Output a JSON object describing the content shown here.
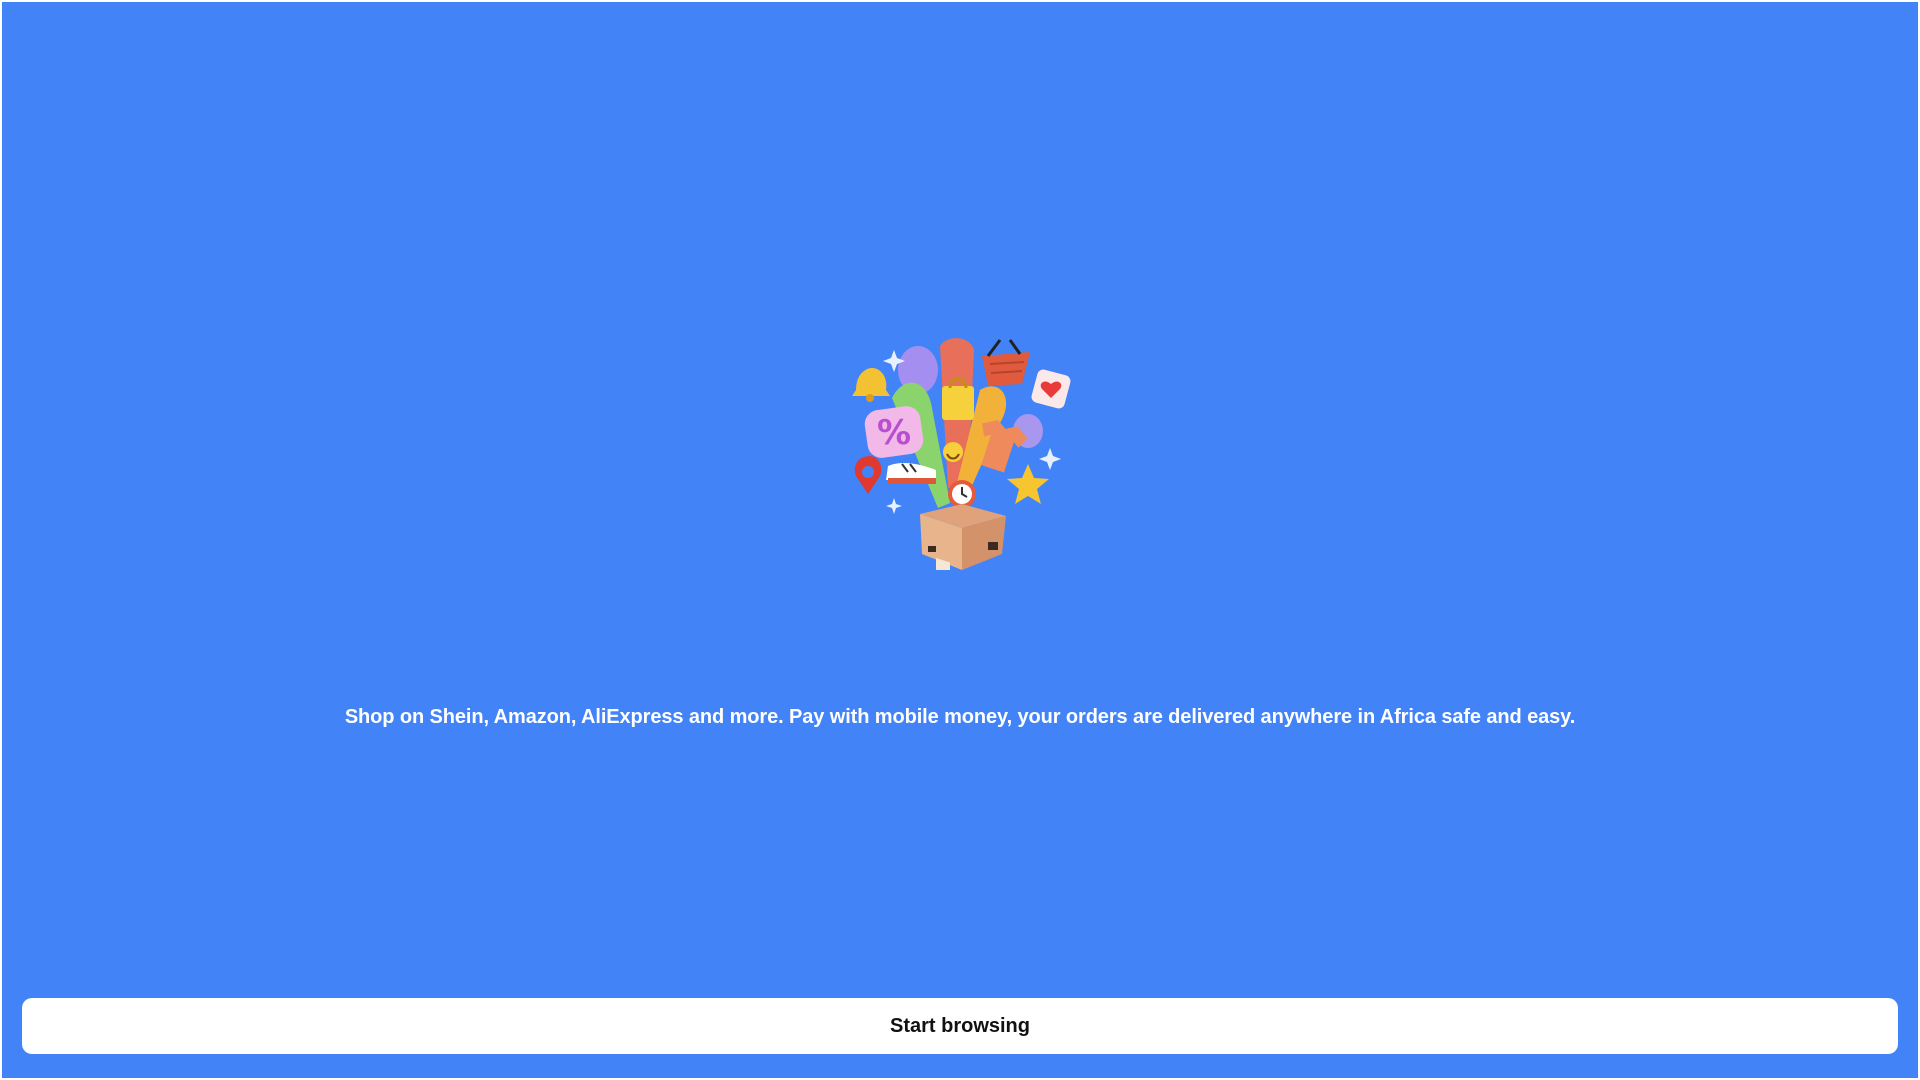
{
  "hero": {
    "illustration": "gift-box-burst-illustration"
  },
  "tagline": "Shop on Shein, Amazon, AliExpress and more. Pay with mobile money, your orders are delivered anywhere in Africa safe and easy.",
  "cta": {
    "label": "Start browsing"
  },
  "colors": {
    "background": "#4283f7",
    "button_bg": "#ffffff",
    "button_text": "#111111",
    "text": "#ffffff"
  }
}
